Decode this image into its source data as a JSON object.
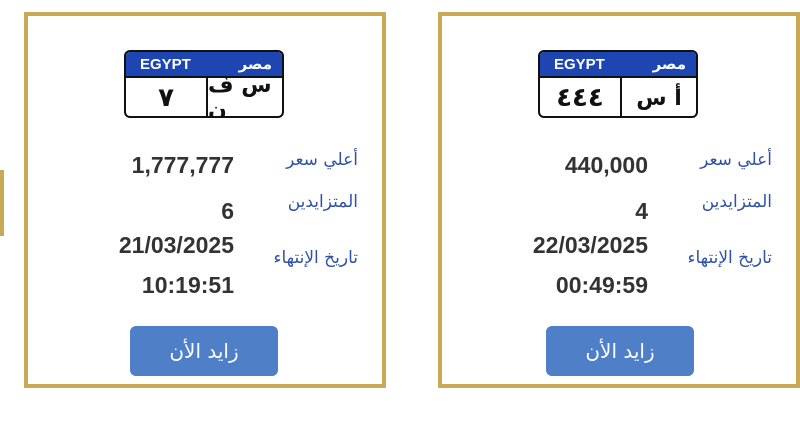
{
  "auctions": [
    {
      "plate": {
        "country_en": "EGYPT",
        "country_ar": "مصر",
        "number": "٧",
        "letters": "س ف ن"
      },
      "highest_price_label": "أعلي سعر",
      "highest_price": "1,777,777",
      "bidders_label": "المتزايدين",
      "bidders": "6",
      "end_date_label": "تاريخ الإنتهاء",
      "end_date": "21/03/2025",
      "end_time": "10:19:51",
      "bid_button": "زايد الأن"
    },
    {
      "plate": {
        "country_en": "EGYPT",
        "country_ar": "مصر",
        "number": "٤٤٤",
        "letters": "أ س"
      },
      "highest_price_label": "أعلي سعر",
      "highest_price": "440,000",
      "bidders_label": "المتزايدين",
      "bidders": "4",
      "end_date_label": "تاريخ الإنتهاء",
      "end_date": "22/03/2025",
      "end_time": "00:49:59",
      "bid_button": "زايد الأن"
    }
  ],
  "colors": {
    "border": "#c8aa56",
    "plate_header": "#1d46b3",
    "label": "#2f52a8",
    "button": "#4f7fc7"
  }
}
